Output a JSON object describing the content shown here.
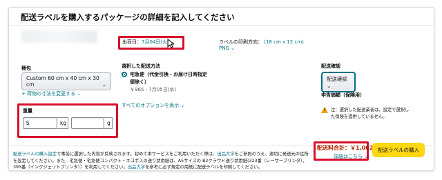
{
  "header": {
    "title": "配送ラベルを購入するパッケージの詳細を記入してください"
  },
  "ship_date": {
    "label": "出荷日：",
    "value": "7月04日(火)",
    "chevron": "⌄"
  },
  "label_print": {
    "label": "ラベルの印刷方向：",
    "size": "(18 cm x 12 cm)",
    "format": "PNG",
    "chevron": "⌄"
  },
  "package": {
    "heading": "梱包",
    "selected": "Custom 60 cm x 40 cm x 30 cm",
    "change_dims_link": "+ 荷物の寸法を変更する",
    "chevron": "⌄"
  },
  "weight": {
    "heading": "重量",
    "value": "5",
    "unit1": "kg",
    "value2": "",
    "unit2": "g"
  },
  "shipping_method": {
    "heading": "選択した配送方法",
    "option_line1": "宅急便（代金引換・お届け日時指定",
    "option_line2": "便除く）",
    "price_date": "￥965 - 7月05日(水)",
    "all_options_link": "すべてのオプションを表示",
    "chevron": "⌄"
  },
  "delivery_confirm": {
    "heading": "配送確認",
    "selected": "配送確認"
  },
  "declared_value": {
    "heading": "申告価額（保険用）",
    "note_line1": "注：選択した配送業者は、設定で選択し",
    "note_line2": "た保険を提供していません。"
  },
  "footer": {
    "link1": "配送ラベルの購入設定",
    "text1": "で事前に選択した内容が反映されます。初めて本サービスをご利用いただく際は、",
    "link2": "出品大学",
    "text2": "をご参照のうえ、適切に発送元の住所を設定してください。また、宅急便・宅急便コンパクト・ネコポスの送り状用紙は、A5サイズの B2クラウド送り状用紙(323番（レーザープリンタ）、395番（インクジェットプリンタ））を利用してください。",
    "link3": "出品大学",
    "text3": "を参考に必ず規定の用紙に配送ラベルを印刷してください。"
  },
  "total": {
    "label": "配送料合計：￥1,062",
    "details_link": "詳細はこちら",
    "chevron": "⌄",
    "buy_button": "配送ラベルの購入"
  },
  "colors": {
    "highlight": "#d6102b",
    "link": "#007185",
    "button": "#ffd814"
  }
}
